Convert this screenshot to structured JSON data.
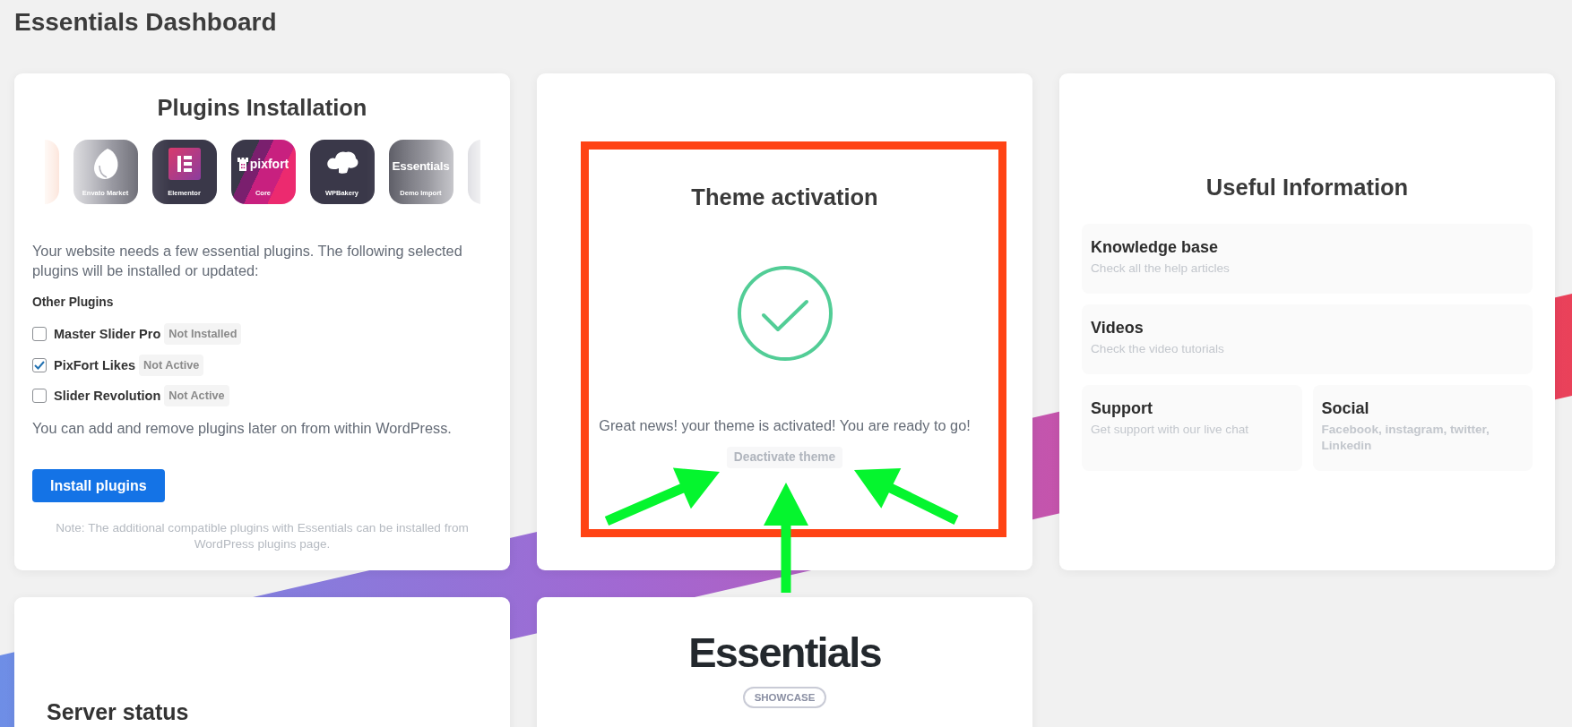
{
  "page": {
    "title": "Essentials Dashboard"
  },
  "plugins_card": {
    "title": "Plugins Installation",
    "plugin_tiles": [
      {
        "kind": "sliver"
      },
      {
        "kind": "envato",
        "label": "Envato Market"
      },
      {
        "kind": "elementor",
        "label": "Elementor"
      },
      {
        "kind": "pixfort",
        "logo_text": "pixfort",
        "label": "Core"
      },
      {
        "kind": "wpbakery",
        "label": "WPBakery"
      },
      {
        "kind": "essentials",
        "logo_text": "Essentials",
        "label": "Demo Import"
      },
      {
        "kind": "ghost"
      }
    ],
    "intro": "Your website needs a few essential plugins. The following selected plugins will be installed or updated:",
    "section_label": "Other Plugins",
    "plugins": [
      {
        "name": "Master Slider Pro",
        "checked": false,
        "status": "Not Installed"
      },
      {
        "name": "PixFort Likes",
        "checked": true,
        "status": "Not Active"
      },
      {
        "name": "Slider Revolution",
        "checked": false,
        "status": "Not Active"
      }
    ],
    "later_text": "You can add and remove plugins later on from within WordPress.",
    "install_button": "Install plugins",
    "note": "Note: The additional compatible plugins with Essentials can be installed from WordPress plugins page."
  },
  "theme_card": {
    "title": "Theme activation",
    "activated": true,
    "message": "Great news! your theme is activated! You are ready to go!",
    "deactivate_button": "Deactivate theme"
  },
  "info_card": {
    "title": "Useful Information",
    "items": [
      {
        "kind": "article",
        "wide": true,
        "title": "Knowledge base",
        "description": "Check all the help articles"
      },
      {
        "kind": "article",
        "wide": true,
        "title": "Videos",
        "description": "Check the video tutorials"
      },
      {
        "kind": "article",
        "wide": false,
        "title": "Support",
        "description": "Get support with our live chat"
      },
      {
        "kind": "links",
        "wide": false,
        "title": "Social",
        "description": "Facebook, instagram, twitter, Linkedin"
      }
    ]
  },
  "server_card": {
    "title": "Server status"
  },
  "showcase_card": {
    "title": "Essentials",
    "badge": "SHOWCASE"
  }
}
